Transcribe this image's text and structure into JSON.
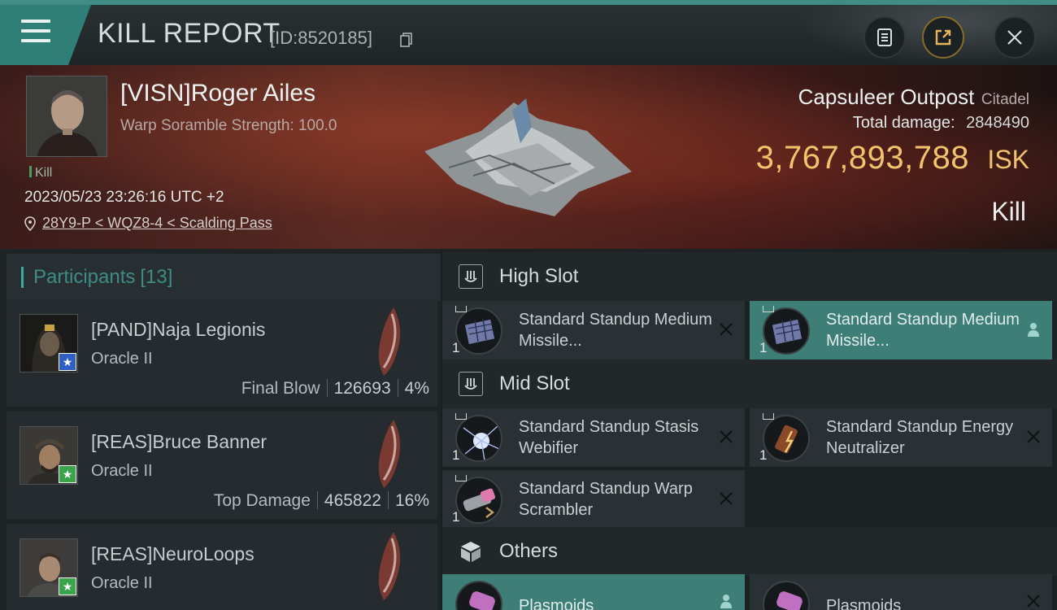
{
  "header": {
    "title": "KILL REPORT",
    "id_text": "[ID:8520185]"
  },
  "victim": {
    "name": "[VISN]Roger Ailes",
    "subtitle": "Warp Soramble Strength: 100.0",
    "tag": "Kill",
    "datetime": "2023/05/23 23:26:16 UTC +2",
    "location": "28Y9-P < WQZ8-4 < Scalding Pass",
    "structure_name": "Capsuleer Outpost",
    "structure_type": "Citadel",
    "total_damage_label": "Total damage:",
    "total_damage_value": "2848490",
    "isk_value": "3,767,893,788",
    "isk_unit": "ISK",
    "result": "Kill"
  },
  "participants": {
    "title": "Participants",
    "count": "[13]",
    "items": [
      {
        "name": "[PAND]Naja Legionis",
        "ship": "Oracle II",
        "role": "Final Blow",
        "damage": "126693",
        "percent": "4%",
        "badge_color": "#2f5fc4"
      },
      {
        "name": "[REAS]Bruce Banner",
        "ship": "Oracle II",
        "role": "Top Damage",
        "damage": "465822",
        "percent": "16%",
        "badge_color": "#3aa44a"
      },
      {
        "name": "[REAS]NeuroLoops",
        "ship": "Oracle II",
        "role": "",
        "damage": "",
        "percent": "",
        "badge_color": "#3aa44a"
      }
    ]
  },
  "fitting": {
    "high_slot": {
      "title": "High Slot",
      "modules": [
        {
          "name": "Standard Standup Medium Missile...",
          "qty": "1",
          "active": false
        },
        {
          "name": "Standard Standup Medium Missile...",
          "qty": "1",
          "active": true
        }
      ]
    },
    "mid_slot": {
      "title": "Mid Slot",
      "modules": [
        {
          "name": "Standard Standup Stasis Webifier",
          "qty": "1",
          "active": false
        },
        {
          "name": "Standard Standup Energy Neutralizer",
          "qty": "1",
          "active": false
        },
        {
          "name": "Standard Standup Warp Scrambler",
          "qty": "1",
          "active": false
        }
      ]
    },
    "others": {
      "title": "Others",
      "modules": [
        {
          "name": "Plasmoids",
          "active": true
        },
        {
          "name": "Plasmoids",
          "active": false
        }
      ]
    }
  },
  "icons": [
    "menu-icon",
    "copy-icon",
    "clipboard-icon",
    "share-icon",
    "close-icon",
    "location-pin-icon",
    "high-slot-icon",
    "mid-slot-icon",
    "cube-icon",
    "person-icon",
    "remove-icon",
    "star-icon"
  ]
}
